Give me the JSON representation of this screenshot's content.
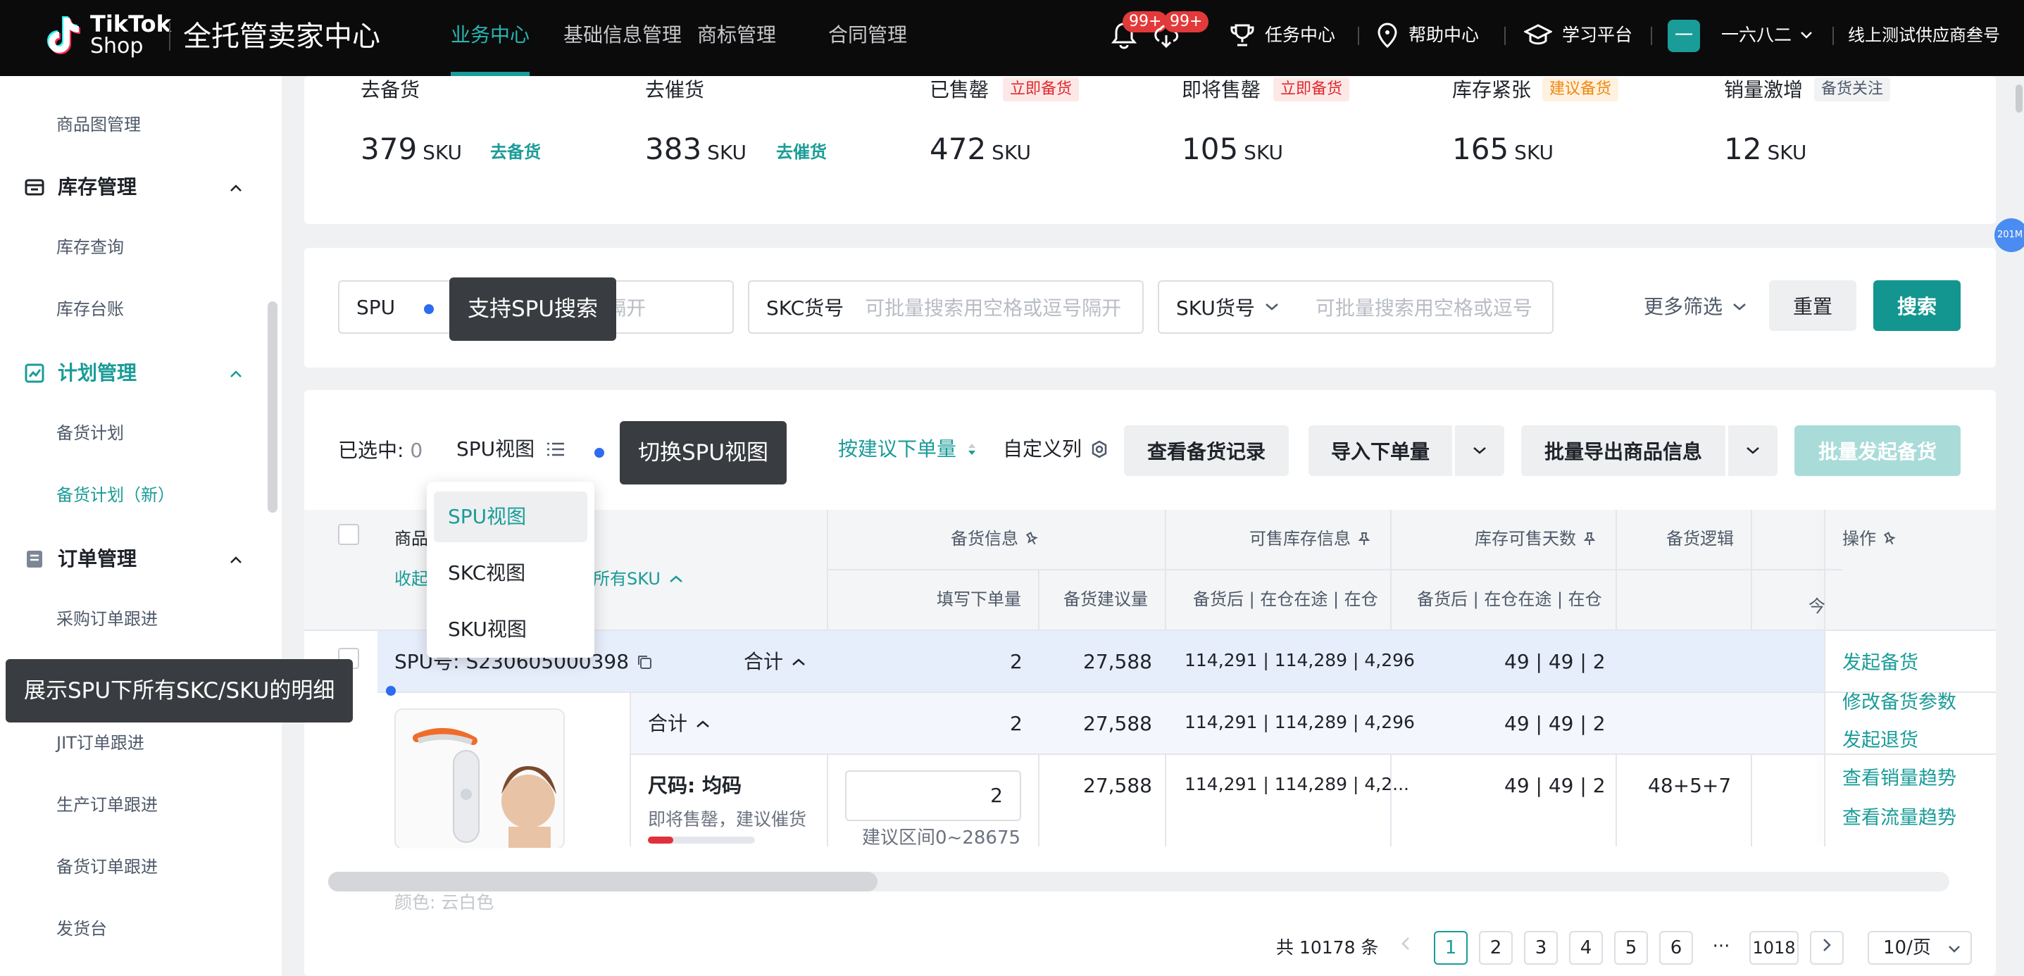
{
  "header": {
    "logo_line1": "TikTok",
    "logo_line2": "Shop",
    "app_title": "全托管卖家中心",
    "nav": [
      "业务中心",
      "基础信息管理",
      "商标管理",
      "合同管理"
    ],
    "notif_badge_1": "99+",
    "notif_badge_2": "99+",
    "task_center": "任务中心",
    "help_center": "帮助中心",
    "learning_platform": "学习平台",
    "avatar_char": "一",
    "user_name": "一六八二",
    "account_label": "线上测试供应商叁号"
  },
  "sidebar": {
    "items_top": [
      "商品图管理"
    ],
    "groups": [
      {
        "title": "库存管理",
        "children": [
          "库存查询",
          "库存台账"
        ]
      },
      {
        "title": "计划管理",
        "children": [
          "备货计划",
          "备货计划（新）"
        ]
      },
      {
        "title": "订单管理",
        "children": [
          "采购订单跟进",
          "JIT订单跟进",
          "生产订单跟进",
          "备货订单跟进",
          "发货台"
        ]
      }
    ]
  },
  "stats": [
    {
      "label": "去备货",
      "value": "379",
      "unit": "SKU",
      "link": "去备货",
      "tag": ""
    },
    {
      "label": "去催货",
      "value": "383",
      "unit": "SKU",
      "link": "去催货",
      "tag": ""
    },
    {
      "label": "已售罄",
      "value": "472",
      "unit": "SKU",
      "link": "",
      "tag": "立即备货"
    },
    {
      "label": "即将售罄",
      "value": "105",
      "unit": "SKU",
      "link": "",
      "tag": "立即备货"
    },
    {
      "label": "库存紧张",
      "value": "165",
      "unit": "SKU",
      "link": "",
      "tag": "建议备货"
    },
    {
      "label": "销量激增",
      "value": "12",
      "unit": "SKU",
      "link": "",
      "tag": "备货关注"
    }
  ],
  "filters": {
    "spu_label": "SPU",
    "spu_placeholder_tail": "隔开",
    "skc_label": "SKC货号",
    "skc_placeholder": "可批量搜索用空格或逗号隔开",
    "sku_label": "SKU货号",
    "sku_placeholder": "可批量搜索用空格或逗号",
    "more_filters": "更多筛选",
    "reset": "重置",
    "search": "搜索"
  },
  "tooltips": {
    "spu_search": "支持SPU搜索",
    "switch_view": "切换SPU视图",
    "show_detail": "展示SPU下所有SKC/SKU的明细"
  },
  "toolbar": {
    "selected_label": "已选中:",
    "selected_count": "0",
    "view_label": "SPU视图",
    "order_by_suggest": "按建议下单量",
    "custom_columns": "自定义列",
    "view_records": "查看备货记录",
    "import_orders": "导入下单量",
    "batch_export": "批量导出商品信息",
    "batch_stock": "批量发起备货"
  },
  "view_dropdown": [
    "SPU视图",
    "SKC视图",
    "SKU视图"
  ],
  "table": {
    "col_product": "商品",
    "collapse_text": "收起",
    "all_sku_text": "所有SKU",
    "group_stock_info": "备货信息",
    "group_sellable": "可售库存信息",
    "group_days": "库存可售天数",
    "col_logic": "备货逻辑",
    "col_ops": "操作",
    "col_today_partial": "今",
    "sub_fill_qty": "填写下单量",
    "sub_suggest_qty": "备货建议量",
    "sub_sellable": "备货后 | 在仓在途 | 在仓",
    "sub_days": "备货后 | 在仓在途 | 在仓",
    "spu_row": {
      "spu_no": "SPU号: S230605000398",
      "total_label": "合计",
      "fill_qty": "2",
      "suggest_qty": "27,588",
      "sellable": "114,291 | 114,289 | 4,296",
      "days": "49 | 49 | 2"
    },
    "skc_total_row": {
      "total_label": "合计",
      "fill_qty": "2",
      "suggest_qty": "27,588",
      "sellable": "114,291 | 114,289 | 4,296",
      "days": "49 | 49 | 2"
    },
    "sku_row": {
      "size": "尺码: 均码",
      "status": "即将售罄，建议催货",
      "input_value": "2",
      "range_hint": "建议区间0~28675",
      "suggest_qty": "27,588",
      "sellable": "114,291 | 114,289 | 4,2...",
      "days": "49 | 49 | 2",
      "logic": "48+5+7"
    },
    "color_label": "颜色: 云白色",
    "ops": [
      "发起备货",
      "修改备货参数",
      "发起退货",
      "查看销量趋势",
      "查看流量趋势"
    ]
  },
  "pagination": {
    "total": "共 10178 条",
    "pages": [
      "1",
      "2",
      "3",
      "4",
      "5",
      "6"
    ],
    "ellipsis": "···",
    "last": "1018",
    "current": "1",
    "page_size": "10/页"
  },
  "floating_badge": "201M",
  "colors": {
    "accent": "#1a9c98",
    "topbar": "#0b0b0c",
    "tooltip": "#393c40",
    "dot": "#2d6bf0"
  }
}
